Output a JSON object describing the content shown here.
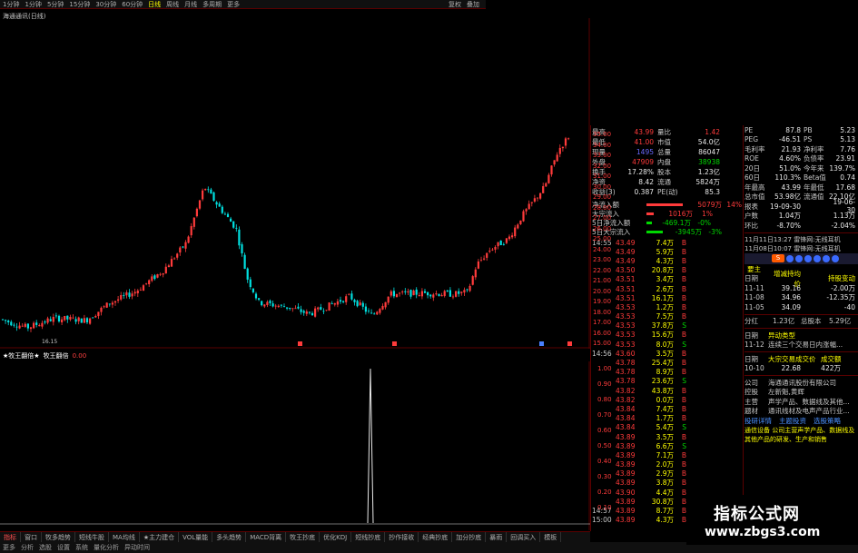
{
  "toolbar": {
    "items": [
      "1分钟",
      "1分钟",
      "5分钟",
      "15分钟",
      "30分钟",
      "60分钟",
      "日线",
      "周线",
      "月线",
      "多周期",
      "更多"
    ],
    "active_index": 6,
    "right_items": [
      "复权",
      "叠加"
    ]
  },
  "chart_title": "海通通讯(日线)",
  "kline": {
    "price_axis": [
      "35.00",
      "34.00",
      "33.00",
      "32.00",
      "31.00",
      "30.00",
      "29.00",
      "28.00",
      "27.00",
      "26.00",
      "25.00",
      "24.00",
      "23.00",
      "22.00",
      "21.00",
      "20.00",
      "19.00",
      "18.00",
      "17.00",
      "16.00",
      "15.00"
    ],
    "low_label": "16.15",
    "colors": {
      "up": "#ff3b3b",
      "down": "#00e0e0",
      "grid": "#5a0000"
    }
  },
  "indicator": {
    "name": "★牧王翻倍★",
    "title": "牧王翻倍",
    "value": "0.00",
    "axis": [
      "1.00",
      "0.90",
      "0.80",
      "0.70",
      "0.60",
      "0.50",
      "0.40",
      "0.30",
      "0.20",
      "0.10"
    ],
    "spike_value": 1.0
  },
  "bottom_tabs": [
    "指标",
    "窗口",
    "牧多趋势",
    "短线牛股",
    "MA均线",
    "★主力建仓",
    "VOL量能",
    "多头趋势",
    "MACD背离",
    "牧王抄底",
    "优化KDJ",
    "短线抄底",
    "抄作接收",
    "经典抄底",
    "加分抄底",
    "暴雨",
    "回调买入",
    "模板"
  ],
  "status_bar": [
    "更多",
    "分析",
    "选股",
    "设置",
    "系统",
    "量化分析",
    "异动时间"
  ],
  "stats": [
    {
      "l": "最高",
      "v": "43.99",
      "vc": "red",
      "l2": "量比",
      "v2": "1.42",
      "v2c": "red"
    },
    {
      "l": "最低",
      "v": "41.00",
      "vc": "red",
      "l2": "市值",
      "v2": "54.0亿",
      "v2c": "white"
    },
    {
      "l": "现量",
      "v": "1495",
      "vc": "blue",
      "l2": "总量",
      "v2": "86047",
      "v2c": "white"
    },
    {
      "l": "外盘",
      "v": "47909",
      "vc": "red",
      "l2": "内盘",
      "v2": "38938",
      "v2c": "green"
    },
    {
      "l": "换手",
      "v": "17.28%",
      "vc": "white",
      "l2": "股本",
      "v2": "1.23亿",
      "v2c": "white"
    },
    {
      "l": "净资",
      "v": "8.42",
      "vc": "white",
      "l2": "流通",
      "v2": "5824万",
      "v2c": "white"
    },
    {
      "l": "收益(3)",
      "v": "0.387",
      "vc": "white",
      "l2": "PE(动)",
      "v2": "85.3",
      "v2c": "white"
    }
  ],
  "flows": [
    {
      "l": "净流入额",
      "v": "5079万",
      "vc": "red",
      "p": "14%",
      "bar": 40,
      "bc": "#ff3b3b"
    },
    {
      "l": "大宗流入",
      "v": "1016万",
      "vc": "red",
      "p": "1%",
      "bar": 8,
      "bc": "#ff3b3b"
    },
    {
      "l": "5日净流入额",
      "v": "-469.1万",
      "vc": "green",
      "p": "-0%",
      "bar": 6,
      "bc": "#00d800"
    },
    {
      "l": "5日大宗流入",
      "v": "-3945万",
      "vc": "green",
      "p": "-3%",
      "bar": 18,
      "bc": "#00d800"
    }
  ],
  "tick_times": [
    "14:55",
    "14:56",
    "14:57",
    "15:00"
  ],
  "ticks": [
    {
      "p": "43.49",
      "v": "7.4万",
      "bs": "B"
    },
    {
      "p": "43.49",
      "v": "5.9万",
      "bs": "B"
    },
    {
      "p": "43.49",
      "v": "4.3万",
      "bs": "B"
    },
    {
      "p": "43.50",
      "v": "20.8万",
      "bs": "B"
    },
    {
      "p": "43.51",
      "v": "3.4万",
      "bs": "B"
    },
    {
      "p": "43.51",
      "v": "2.6万",
      "bs": "B"
    },
    {
      "p": "43.51",
      "v": "16.1万",
      "bs": "B"
    },
    {
      "p": "43.53",
      "v": "1.2万",
      "bs": "B"
    },
    {
      "p": "43.53",
      "v": "7.5万",
      "bs": "B"
    },
    {
      "p": "43.53",
      "v": "37.8万",
      "bs": "S"
    },
    {
      "p": "43.53",
      "v": "15.6万",
      "bs": "B"
    },
    {
      "p": "43.53",
      "v": "8.0万",
      "bs": "S"
    },
    {
      "p": "43.60",
      "v": "3.5万",
      "bs": "B"
    },
    {
      "p": "43.78",
      "v": "25.4万",
      "bs": "B"
    },
    {
      "p": "43.78",
      "v": "8.9万",
      "bs": "B"
    },
    {
      "p": "43.78",
      "v": "23.6万",
      "bs": "S"
    },
    {
      "p": "43.82",
      "v": "43.8万",
      "bs": "B"
    },
    {
      "p": "43.82",
      "v": "0.0万",
      "bs": "B"
    },
    {
      "p": "43.84",
      "v": "7.4万",
      "bs": "B"
    },
    {
      "p": "43.84",
      "v": "1.7万",
      "bs": "B"
    },
    {
      "p": "43.84",
      "v": "5.4万",
      "bs": "S"
    },
    {
      "p": "43.89",
      "v": "3.5万",
      "bs": "B"
    },
    {
      "p": "43.89",
      "v": "6.6万",
      "bs": "S"
    },
    {
      "p": "43.89",
      "v": "7.1万",
      "bs": "B"
    },
    {
      "p": "43.89",
      "v": "2.0万",
      "bs": "B"
    },
    {
      "p": "43.89",
      "v": "2.9万",
      "bs": "B"
    },
    {
      "p": "43.89",
      "v": "3.8万",
      "bs": "B"
    },
    {
      "p": "43.90",
      "v": "4.4万",
      "bs": "B"
    },
    {
      "p": "43.89",
      "v": "30.8万",
      "bs": "B"
    },
    {
      "p": "43.89",
      "v": "8.7万",
      "bs": "B"
    },
    {
      "p": "43.89",
      "v": "4.3万",
      "bs": "B"
    }
  ],
  "fin": [
    {
      "a": "PE",
      "b": "87.8",
      "c": "PB",
      "d": "5.23"
    },
    {
      "a": "PEG",
      "b": "-46.51",
      "c": "PS",
      "d": "5.13"
    },
    {
      "a": "毛利率",
      "b": "21.93",
      "c": "净利率",
      "d": "7.76"
    },
    {
      "a": "ROE",
      "b": "4.60%",
      "c": "负债率",
      "d": "23.91"
    },
    {
      "a": "20日",
      "b": "51.0%",
      "c": "今年来",
      "d": "139.7%"
    },
    {
      "a": "60日",
      "b": "110.3%",
      "c": "Beta值",
      "d": "0.74"
    },
    {
      "a": "年最高",
      "b": "43.99",
      "c": "年最低",
      "d": "17.68"
    },
    {
      "a": "总市值",
      "b": "53.98亿",
      "c": "流通值",
      "d": "22.10亿"
    },
    {
      "a": "报表",
      "b": "19-09-30",
      "c": "",
      "d": "19-06-30"
    },
    {
      "a": "户数",
      "b": "1.04万",
      "c": "",
      "d": "1.13万"
    },
    {
      "a": "环比",
      "b": "-8.70%",
      "c": "",
      "d": "-2.04%"
    }
  ],
  "news": [
    "11月11日13:27 雷锋网:无线耳机",
    "11月08日10:07 雷锋网:无线耳机"
  ],
  "holders_title": "要主",
  "holders_header": [
    "日期",
    "增减持均价",
    "持股变动"
  ],
  "holders": [
    {
      "d": "11-11",
      "p": "39.16",
      "c": "-2.00万"
    },
    {
      "d": "11-08",
      "p": "34.96",
      "c": "-12.35万"
    },
    {
      "d": "11-05",
      "p": "34.09",
      "c": "-40"
    }
  ],
  "share_row": [
    "分红",
    "1.23亿",
    "总股本",
    "5.29亿"
  ],
  "events_header": [
    "日期",
    "异动类型"
  ],
  "events": [
    {
      "d": "11-12",
      "t": "连续三个交易日内涨幅..."
    }
  ],
  "block_header": [
    "日期",
    "大宗交易成交价",
    "成交额"
  ],
  "block": [
    {
      "d": "10-10",
      "p": "22.68",
      "v": "422万"
    }
  ],
  "company": [
    {
      "k": "公司",
      "v": "海通通讯股份有限公司"
    },
    {
      "k": "控股",
      "v": "左新魁,黄辉"
    },
    {
      "k": "主营",
      "v": "声学产品、数据线及其他..."
    },
    {
      "k": "题材",
      "v": "通讯线材及电声产品行业..."
    }
  ],
  "links": [
    "投研详情",
    "主题投资",
    "选股策略"
  ],
  "profile": "通信设备 公司主营声学产品、数据线及其他产品的研发、生产和销售",
  "watermark": {
    "line1": "指标公式网",
    "line2": "www.zbgs3.com"
  }
}
